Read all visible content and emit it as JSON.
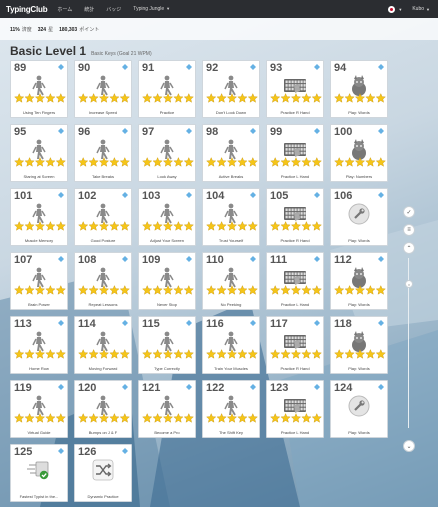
{
  "topbar": {
    "brand": "TypingClub",
    "nav": [
      "ホーム",
      "統計",
      "バッジ",
      "Typing Jungle"
    ],
    "user": "Kubo"
  },
  "stats": [
    {
      "value": "11%",
      "label": "済度"
    },
    {
      "value": "324",
      "label": "星"
    },
    {
      "value": "180,303",
      "label": "ポイント"
    }
  ],
  "heading": {
    "title": "Basic Level 1",
    "subtitle": "Basic Keys (Goal 21 WPM)"
  },
  "colors": {
    "star": "#f5c518",
    "accent": "#4aa3df",
    "topbar": "#2b2d31",
    "check": "#3a9a3a"
  },
  "lessons": [
    {
      "num": "89",
      "label": "Using Ten Fingers",
      "type": "walker",
      "stars": 5
    },
    {
      "num": "90",
      "label": "Increase Speed",
      "type": "walker",
      "stars": 5
    },
    {
      "num": "91",
      "label": "Practice",
      "type": "walker",
      "stars": 5
    },
    {
      "num": "92",
      "label": "Don't Look Down",
      "type": "walker",
      "stars": 5
    },
    {
      "num": "93",
      "label": "Practice R Hand",
      "type": "keyboard",
      "stars": 5
    },
    {
      "num": "94",
      "label": "Play: Words",
      "type": "animal",
      "stars": 5
    },
    {
      "num": "95",
      "label": "Staring at Screen",
      "type": "walker",
      "stars": 5
    },
    {
      "num": "96",
      "label": "Take Breaks",
      "type": "walker",
      "stars": 5
    },
    {
      "num": "97",
      "label": "Look Away",
      "type": "walker",
      "stars": 5
    },
    {
      "num": "98",
      "label": "Active Breaks",
      "type": "walker",
      "stars": 5
    },
    {
      "num": "99",
      "label": "Practice L Hand",
      "type": "keyboard",
      "stars": 5
    },
    {
      "num": "100",
      "label": "Play: Numbers",
      "type": "animal",
      "stars": 5
    },
    {
      "num": "101",
      "label": "Muscle Memory",
      "type": "walker",
      "stars": 5
    },
    {
      "num": "102",
      "label": "Good Posture",
      "type": "walker",
      "stars": 5
    },
    {
      "num": "103",
      "label": "Adjust Your Screen",
      "type": "walker",
      "stars": 5
    },
    {
      "num": "104",
      "label": "Trust Yourself",
      "type": "walker",
      "stars": 5
    },
    {
      "num": "105",
      "label": "Practice R Hand",
      "type": "keyboard",
      "stars": 5
    },
    {
      "num": "106",
      "label": "Play: Words",
      "type": "wrench",
      "stars": 0
    },
    {
      "num": "107",
      "label": "Brain Power",
      "type": "walker",
      "stars": 5
    },
    {
      "num": "108",
      "label": "Repeat Lessons",
      "type": "walker",
      "stars": 5
    },
    {
      "num": "109",
      "label": "Never Stop",
      "type": "walker",
      "stars": 5
    },
    {
      "num": "110",
      "label": "No Peeking",
      "type": "walker",
      "stars": 5
    },
    {
      "num": "111",
      "label": "Practice L Hand",
      "type": "keyboard",
      "stars": 5
    },
    {
      "num": "112",
      "label": "Play: Words",
      "type": "animal",
      "stars": 5
    },
    {
      "num": "113",
      "label": "Home Row",
      "type": "walker",
      "stars": 5
    },
    {
      "num": "114",
      "label": "Moving Forward",
      "type": "walker",
      "stars": 5
    },
    {
      "num": "115",
      "label": "Type Correctly",
      "type": "walker",
      "stars": 5
    },
    {
      "num": "116",
      "label": "Train Your Muscles",
      "type": "walker",
      "stars": 5
    },
    {
      "num": "117",
      "label": "Practice R Hand",
      "type": "keyboard",
      "stars": 5
    },
    {
      "num": "118",
      "label": "Play: Words",
      "type": "animal",
      "stars": 5
    },
    {
      "num": "119",
      "label": "Virtual Guide",
      "type": "walker",
      "stars": 5
    },
    {
      "num": "120",
      "label": "Bumps on J & F",
      "type": "walker",
      "stars": 5
    },
    {
      "num": "121",
      "label": "Become a Pro",
      "type": "walker",
      "stars": 5
    },
    {
      "num": "122",
      "label": "The Shift Key",
      "type": "walker",
      "stars": 5
    },
    {
      "num": "123",
      "label": "Practice L Hand",
      "type": "keyboard",
      "stars": 5
    },
    {
      "num": "124",
      "label": "Play: Words",
      "type": "wrench",
      "stars": 0
    },
    {
      "num": "125",
      "label": "Fastest Typist in the...",
      "type": "speed",
      "stars": 0
    },
    {
      "num": "126",
      "label": "Dynamic Practice",
      "type": "shuffle",
      "stars": 0
    }
  ],
  "rail": {
    "icons": [
      "check-circle-icon",
      "list-icon",
      "chevron-up-icon",
      "scroll-dot-icon",
      "chevron-down-icon"
    ]
  }
}
